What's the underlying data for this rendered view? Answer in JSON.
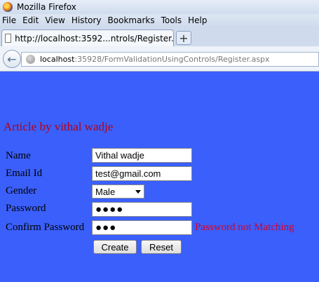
{
  "window": {
    "title": "Mozilla Firefox"
  },
  "menu": {
    "items": [
      "File",
      "Edit",
      "View",
      "History",
      "Bookmarks",
      "Tools",
      "Help"
    ]
  },
  "tab": {
    "label": "http://localhost:3592...ntrols/Register.aspx",
    "newtab": "+"
  },
  "nav": {
    "url_host": "localhost",
    "url_rest": ":35928/FormValidationUsingControls/Register.aspx"
  },
  "page": {
    "heading": "Article by vithal wadje",
    "fields": {
      "name_label": "Name",
      "name_value": "Vithal wadje",
      "email_label": "Email Id",
      "email_value": "test@gmail.com",
      "gender_label": "Gender",
      "gender_value": "Male",
      "password_label": "Password",
      "password_value": "●●●●",
      "confirm_label": "Confirm Password",
      "confirm_value": "●●●",
      "confirm_error": "Password not Matching"
    },
    "buttons": {
      "create": "Create",
      "reset": "Reset"
    }
  },
  "colors": {
    "page_background": "#3a5ffb",
    "heading": "#b50012",
    "error": "#d6002a"
  }
}
